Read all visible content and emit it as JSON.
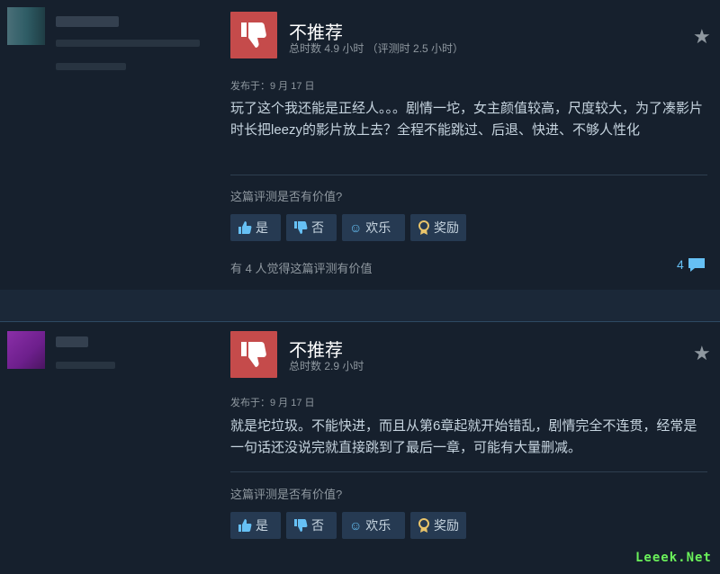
{
  "reviews": [
    {
      "verdict": "不推荐",
      "hours": "总时数 4.9 小时 （评测时 2.5 小时）",
      "posted": "发布于：9 月 17 日",
      "body": "玩了这个我还能是正经人。。。剧情一坨，女主颜值较高，尺度较大，为了凑影片时长把leezy的影片放上去？全程不能跳过、后退、快进、不够人性化",
      "helpful_question": "这篇评测是否有价值?",
      "buttons": {
        "yes": "是",
        "no": "否",
        "funny": "欢乐",
        "award": "奖励"
      },
      "helpful_count": "有 4 人觉得这篇评测有价值",
      "comment_count": "4"
    },
    {
      "verdict": "不推荐",
      "hours": "总时数 2.9 小时",
      "posted": "发布于：9 月 17 日",
      "body": "就是坨垃圾。不能快进，而且从第6章起就开始错乱，剧情完全不连贯，经常是一句话还没说完就直接跳到了最后一章，可能有大量删减。",
      "helpful_question": "这篇评测是否有价值?",
      "buttons": {
        "yes": "是",
        "no": "否",
        "funny": "欢乐",
        "award": "奖励"
      }
    }
  ],
  "icons": [
    "thumbs-down-icon",
    "star-icon",
    "thumbs-up-icon",
    "smiley-icon",
    "award-icon",
    "comment-icon"
  ],
  "colors": {
    "background": "#1b2838",
    "panel": "#16202d",
    "thumb_down": "#c54b4b",
    "accent": "#66c0f4"
  },
  "watermark": "Leeek.Net"
}
